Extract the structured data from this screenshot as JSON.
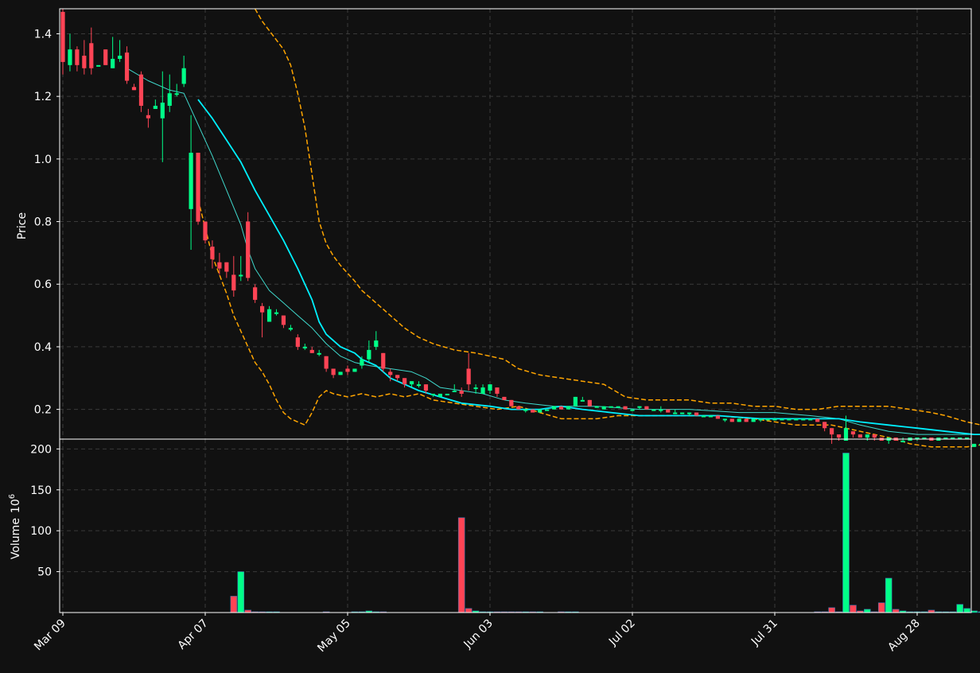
{
  "chart_data": {
    "type": "candlestick",
    "theme": {
      "background": "#111111",
      "up_color": "#00ff88",
      "down_color": "#ff4455",
      "ma_fast_color": "#00f0ff",
      "ma_slow_color": "#3fd8cc",
      "band_color": "#ffa500",
      "grid_color": "#3a3a3a",
      "text_color": "#ffffff"
    },
    "price_panel": {
      "ylabel": "Price",
      "ylim": [
        0.105,
        1.48
      ],
      "yticks": [
        0.2,
        0.4,
        0.6,
        0.8,
        1.0,
        1.2,
        1.4
      ],
      "ytick_labels": [
        "0.2",
        "0.4",
        "0.6",
        "0.8",
        "1.0",
        "1.2",
        "1.4"
      ],
      "grid": true
    },
    "volume_panel": {
      "ylabel": "Volume",
      "ylabel_exponent": "10",
      "ylabel_power": "6",
      "ylim": [
        0,
        212
      ],
      "yticks": [
        50,
        100,
        150,
        200
      ],
      "ytick_labels": [
        "50",
        "100",
        "150",
        "200"
      ],
      "grid": true
    },
    "x_axis": {
      "n_bars": 130,
      "ticks": [
        {
          "index": 0,
          "label": "Mar 09"
        },
        {
          "index": 20,
          "label": "Apr 07"
        },
        {
          "index": 40,
          "label": "May 05"
        },
        {
          "index": 60,
          "label": "Jun 03"
        },
        {
          "index": 80,
          "label": "Jul 02"
        },
        {
          "index": 100,
          "label": "Jul 31"
        },
        {
          "index": 120,
          "label": "Aug 28"
        }
      ]
    },
    "candles": [
      [
        1.47,
        1.31,
        1.48,
        1.27
      ],
      [
        1.3,
        1.35,
        1.4,
        1.28
      ],
      [
        1.35,
        1.3,
        1.36,
        1.28
      ],
      [
        1.33,
        1.29,
        1.38,
        1.27
      ],
      [
        1.37,
        1.29,
        1.42,
        1.27
      ],
      [
        1.3,
        1.3,
        1.3,
        1.3
      ],
      [
        1.35,
        1.3,
        1.35,
        1.3
      ],
      [
        1.29,
        1.32,
        1.39,
        1.29
      ],
      [
        1.32,
        1.33,
        1.38,
        1.31
      ],
      [
        1.34,
        1.25,
        1.36,
        1.24
      ],
      [
        1.23,
        1.22,
        1.24,
        1.22
      ],
      [
        1.27,
        1.17,
        1.28,
        1.15
      ],
      [
        1.14,
        1.13,
        1.16,
        1.1
      ],
      [
        1.16,
        1.17,
        1.19,
        1.16
      ],
      [
        1.13,
        1.18,
        1.28,
        0.99
      ],
      [
        1.17,
        1.21,
        1.27,
        1.15
      ],
      [
        1.21,
        1.21,
        1.24,
        1.2
      ],
      [
        1.24,
        1.29,
        1.33,
        1.23
      ],
      [
        0.84,
        1.02,
        1.14,
        0.71
      ],
      [
        1.02,
        0.8,
        1.02,
        0.79
      ],
      [
        0.8,
        0.74,
        0.8,
        0.73
      ],
      [
        0.72,
        0.68,
        0.74,
        0.65
      ],
      [
        0.67,
        0.65,
        0.7,
        0.63
      ],
      [
        0.67,
        0.64,
        0.67,
        0.62
      ],
      [
        0.63,
        0.58,
        0.69,
        0.56
      ],
      [
        0.63,
        0.63,
        0.69,
        0.61
      ],
      [
        0.8,
        0.62,
        0.83,
        0.61
      ],
      [
        0.59,
        0.55,
        0.6,
        0.54
      ],
      [
        0.53,
        0.51,
        0.54,
        0.43
      ],
      [
        0.48,
        0.52,
        0.53,
        0.48
      ],
      [
        0.51,
        0.51,
        0.52,
        0.5
      ],
      [
        0.5,
        0.47,
        0.5,
        0.46
      ],
      [
        0.46,
        0.46,
        0.47,
        0.45
      ],
      [
        0.43,
        0.4,
        0.44,
        0.39
      ],
      [
        0.4,
        0.4,
        0.41,
        0.39
      ],
      [
        0.39,
        0.38,
        0.4,
        0.38
      ],
      [
        0.38,
        0.38,
        0.39,
        0.37
      ],
      [
        0.37,
        0.33,
        0.37,
        0.32
      ],
      [
        0.33,
        0.31,
        0.33,
        0.3
      ],
      [
        0.31,
        0.32,
        0.32,
        0.31
      ],
      [
        0.33,
        0.32,
        0.34,
        0.31
      ],
      [
        0.32,
        0.33,
        0.33,
        0.32
      ],
      [
        0.34,
        0.36,
        0.37,
        0.33
      ],
      [
        0.36,
        0.39,
        0.42,
        0.35
      ],
      [
        0.4,
        0.42,
        0.45,
        0.39
      ],
      [
        0.38,
        0.33,
        0.38,
        0.32
      ],
      [
        0.32,
        0.31,
        0.33,
        0.29
      ],
      [
        0.31,
        0.3,
        0.31,
        0.29
      ],
      [
        0.3,
        0.28,
        0.3,
        0.27
      ],
      [
        0.28,
        0.29,
        0.29,
        0.27
      ],
      [
        0.28,
        0.28,
        0.29,
        0.27
      ],
      [
        0.28,
        0.26,
        0.28,
        0.25
      ],
      [
        0.25,
        0.25,
        0.25,
        0.24
      ],
      [
        0.24,
        0.25,
        0.25,
        0.24
      ],
      [
        0.25,
        0.25,
        0.25,
        0.25
      ],
      [
        0.26,
        0.26,
        0.28,
        0.26
      ],
      [
        0.26,
        0.25,
        0.27,
        0.24
      ],
      [
        0.33,
        0.28,
        0.38,
        0.26
      ],
      [
        0.27,
        0.27,
        0.28,
        0.25
      ],
      [
        0.25,
        0.27,
        0.28,
        0.25
      ],
      [
        0.26,
        0.28,
        0.28,
        0.25
      ],
      [
        0.27,
        0.25,
        0.27,
        0.24
      ],
      [
        0.24,
        0.23,
        0.24,
        0.23
      ],
      [
        0.23,
        0.21,
        0.23,
        0.21
      ],
      [
        0.21,
        0.2,
        0.21,
        0.2
      ],
      [
        0.2,
        0.2,
        0.2,
        0.19
      ],
      [
        0.2,
        0.19,
        0.2,
        0.19
      ],
      [
        0.19,
        0.2,
        0.2,
        0.19
      ],
      [
        0.2,
        0.2,
        0.2,
        0.2
      ],
      [
        0.2,
        0.21,
        0.21,
        0.2
      ],
      [
        0.21,
        0.2,
        0.21,
        0.2
      ],
      [
        0.2,
        0.21,
        0.21,
        0.2
      ],
      [
        0.21,
        0.24,
        0.24,
        0.21
      ],
      [
        0.23,
        0.23,
        0.24,
        0.23
      ],
      [
        0.23,
        0.21,
        0.23,
        0.21
      ],
      [
        0.21,
        0.21,
        0.21,
        0.21
      ],
      [
        0.2,
        0.21,
        0.21,
        0.2
      ],
      [
        0.21,
        0.21,
        0.21,
        0.21
      ],
      [
        0.21,
        0.21,
        0.21,
        0.21
      ],
      [
        0.21,
        0.2,
        0.21,
        0.2
      ],
      [
        0.2,
        0.2,
        0.2,
        0.2
      ],
      [
        0.21,
        0.21,
        0.21,
        0.2
      ],
      [
        0.21,
        0.2,
        0.21,
        0.2
      ],
      [
        0.2,
        0.2,
        0.2,
        0.2
      ],
      [
        0.2,
        0.2,
        0.21,
        0.19
      ],
      [
        0.2,
        0.19,
        0.2,
        0.19
      ],
      [
        0.19,
        0.19,
        0.2,
        0.19
      ],
      [
        0.19,
        0.19,
        0.19,
        0.19
      ],
      [
        0.19,
        0.19,
        0.19,
        0.18
      ],
      [
        0.19,
        0.18,
        0.19,
        0.18
      ],
      [
        0.18,
        0.18,
        0.18,
        0.18
      ],
      [
        0.18,
        0.18,
        0.18,
        0.18
      ],
      [
        0.18,
        0.17,
        0.18,
        0.17
      ],
      [
        0.17,
        0.17,
        0.17,
        0.16
      ],
      [
        0.17,
        0.16,
        0.17,
        0.16
      ],
      [
        0.16,
        0.17,
        0.17,
        0.16
      ],
      [
        0.17,
        0.16,
        0.17,
        0.16
      ],
      [
        0.16,
        0.17,
        0.17,
        0.16
      ],
      [
        0.17,
        0.17,
        0.17,
        0.16
      ],
      [
        0.17,
        0.17,
        0.17,
        0.17
      ],
      [
        0.17,
        0.17,
        0.17,
        0.17
      ],
      [
        0.17,
        0.17,
        0.17,
        0.17
      ],
      [
        0.17,
        0.17,
        0.17,
        0.17
      ],
      [
        0.17,
        0.17,
        0.17,
        0.17
      ],
      [
        0.17,
        0.17,
        0.17,
        0.17
      ],
      [
        0.17,
        0.17,
        0.17,
        0.17
      ],
      [
        0.17,
        0.16,
        0.17,
        0.16
      ],
      [
        0.16,
        0.14,
        0.16,
        0.13
      ],
      [
        0.14,
        0.12,
        0.14,
        0.09
      ],
      [
        0.12,
        0.11,
        0.12,
        0.1
      ],
      [
        0.1,
        0.14,
        0.18,
        0.1
      ],
      [
        0.13,
        0.12,
        0.13,
        0.11
      ],
      [
        0.12,
        0.11,
        0.12,
        0.11
      ],
      [
        0.11,
        0.12,
        0.12,
        0.1
      ],
      [
        0.12,
        0.11,
        0.12,
        0.1
      ],
      [
        0.11,
        0.1,
        0.11,
        0.1
      ],
      [
        0.1,
        0.11,
        0.11,
        0.09
      ],
      [
        0.11,
        0.1,
        0.11,
        0.1
      ],
      [
        0.1,
        0.1,
        0.11,
        0.1
      ],
      [
        0.1,
        0.11,
        0.11,
        0.1
      ],
      [
        0.11,
        0.11,
        0.11,
        0.1
      ],
      [
        0.11,
        0.11,
        0.11,
        0.11
      ],
      [
        0.11,
        0.1,
        0.11,
        0.1
      ],
      [
        0.1,
        0.11,
        0.11,
        0.1
      ],
      [
        0.11,
        0.11,
        0.11,
        0.11
      ],
      [
        0.11,
        0.11,
        0.11,
        0.11
      ],
      [
        0.11,
        0.11,
        0.11,
        0.11
      ],
      [
        0.11,
        0.11,
        0.11,
        0.11
      ],
      [
        0.08,
        0.09,
        0.09,
        0.08
      ],
      [
        0.09,
        0.09,
        0.09,
        0.08
      ]
    ],
    "volume": [
      0,
      0,
      0,
      0,
      0,
      0,
      0,
      0,
      0,
      0,
      0,
      0,
      0,
      0,
      0,
      0,
      0,
      0,
      0,
      0,
      0,
      0,
      0,
      0,
      20,
      50,
      3,
      1,
      0.5,
      0.3,
      0.2,
      0,
      0,
      0,
      0,
      0,
      0,
      0.5,
      0,
      0,
      0,
      0.5,
      1,
      2,
      1,
      0.5,
      0,
      0,
      0,
      0,
      0,
      0,
      0,
      0,
      0,
      0,
      116,
      5,
      2,
      1,
      0.5,
      0.3,
      0.2,
      0.2,
      0.5,
      0.2,
      0.2,
      0.2,
      0,
      0,
      1,
      0.5,
      0.2,
      0,
      0,
      0,
      0,
      0,
      0,
      0,
      0,
      0,
      0,
      0,
      0,
      0,
      0,
      0,
      0,
      0,
      0,
      0,
      0,
      0,
      0,
      0,
      0,
      0,
      0,
      0,
      0,
      0,
      0,
      0,
      0,
      0,
      0.5,
      1,
      6,
      0.5,
      195,
      9,
      2,
      4,
      1,
      12,
      42,
      4,
      2,
      1,
      1,
      1,
      3,
      1,
      0.5,
      0.5,
      10,
      5,
      2,
      1
    ],
    "ma_fast": [
      [
        19,
        1.19
      ],
      [
        21,
        1.13
      ],
      [
        23,
        1.06
      ],
      [
        25,
        0.99
      ],
      [
        27,
        0.9
      ],
      [
        29,
        0.82
      ],
      [
        31,
        0.74
      ],
      [
        33,
        0.65
      ],
      [
        35,
        0.55
      ],
      [
        36,
        0.48
      ],
      [
        37,
        0.44
      ],
      [
        39,
        0.4
      ],
      [
        41,
        0.38
      ],
      [
        42,
        0.36
      ],
      [
        44,
        0.34
      ],
      [
        46,
        0.3
      ],
      [
        48,
        0.28
      ],
      [
        50,
        0.26
      ],
      [
        53,
        0.24
      ],
      [
        56,
        0.22
      ],
      [
        60,
        0.21
      ],
      [
        63,
        0.2
      ],
      [
        67,
        0.2
      ],
      [
        70,
        0.21
      ],
      [
        73,
        0.2
      ],
      [
        77,
        0.19
      ],
      [
        81,
        0.18
      ],
      [
        86,
        0.18
      ],
      [
        92,
        0.18
      ],
      [
        98,
        0.17
      ],
      [
        104,
        0.17
      ],
      [
        109,
        0.17
      ],
      [
        112,
        0.16
      ],
      [
        116,
        0.15
      ],
      [
        120,
        0.14
      ],
      [
        124,
        0.13
      ],
      [
        128,
        0.12
      ],
      [
        130,
        0.12
      ]
    ],
    "ma_slow": [
      [
        9,
        1.29
      ],
      [
        12,
        1.25
      ],
      [
        15,
        1.22
      ],
      [
        17,
        1.21
      ],
      [
        19,
        1.11
      ],
      [
        21,
        1.01
      ],
      [
        23,
        0.9
      ],
      [
        25,
        0.79
      ],
      [
        26,
        0.71
      ],
      [
        27,
        0.65
      ],
      [
        29,
        0.58
      ],
      [
        31,
        0.54
      ],
      [
        33,
        0.5
      ],
      [
        35,
        0.46
      ],
      [
        37,
        0.41
      ],
      [
        39,
        0.37
      ],
      [
        41,
        0.35
      ],
      [
        43,
        0.34
      ],
      [
        46,
        0.33
      ],
      [
        49,
        0.32
      ],
      [
        51,
        0.3
      ],
      [
        53,
        0.27
      ],
      [
        56,
        0.26
      ],
      [
        59,
        0.25
      ],
      [
        62,
        0.23
      ],
      [
        65,
        0.22
      ],
      [
        69,
        0.21
      ],
      [
        75,
        0.21
      ],
      [
        81,
        0.2
      ],
      [
        88,
        0.2
      ],
      [
        95,
        0.19
      ],
      [
        100,
        0.19
      ],
      [
        105,
        0.18
      ],
      [
        109,
        0.17
      ],
      [
        112,
        0.15
      ],
      [
        116,
        0.13
      ],
      [
        120,
        0.12
      ],
      [
        124,
        0.12
      ],
      [
        128,
        0.12
      ],
      [
        130,
        0.12
      ]
    ],
    "band_upper": [
      [
        27,
        1.48
      ],
      [
        28,
        1.44
      ],
      [
        30,
        1.38
      ],
      [
        31,
        1.35
      ],
      [
        32,
        1.3
      ],
      [
        33,
        1.21
      ],
      [
        34,
        1.1
      ],
      [
        35,
        0.95
      ],
      [
        36,
        0.8
      ],
      [
        37,
        0.73
      ],
      [
        38,
        0.69
      ],
      [
        39,
        0.66
      ],
      [
        41,
        0.61
      ],
      [
        42,
        0.58
      ],
      [
        44,
        0.54
      ],
      [
        46,
        0.5
      ],
      [
        48,
        0.46
      ],
      [
        50,
        0.43
      ],
      [
        52,
        0.41
      ],
      [
        55,
        0.39
      ],
      [
        58,
        0.38
      ],
      [
        60,
        0.37
      ],
      [
        62,
        0.36
      ],
      [
        64,
        0.33
      ],
      [
        67,
        0.31
      ],
      [
        70,
        0.3
      ],
      [
        73,
        0.29
      ],
      [
        76,
        0.28
      ],
      [
        79,
        0.24
      ],
      [
        82,
        0.23
      ],
      [
        85,
        0.23
      ],
      [
        88,
        0.23
      ],
      [
        91,
        0.22
      ],
      [
        94,
        0.22
      ],
      [
        97,
        0.21
      ],
      [
        100,
        0.21
      ],
      [
        103,
        0.2
      ],
      [
        106,
        0.2
      ],
      [
        109,
        0.21
      ],
      [
        113,
        0.21
      ],
      [
        116,
        0.21
      ],
      [
        119,
        0.2
      ],
      [
        122,
        0.19
      ],
      [
        124,
        0.18
      ],
      [
        127,
        0.16
      ],
      [
        129,
        0.15
      ],
      [
        130,
        0.14
      ]
    ],
    "band_lower": [
      [
        19,
        0.87
      ],
      [
        20,
        0.78
      ],
      [
        21,
        0.69
      ],
      [
        23,
        0.57
      ],
      [
        24,
        0.5
      ],
      [
        25,
        0.45
      ],
      [
        26,
        0.4
      ],
      [
        27,
        0.35
      ],
      [
        28,
        0.32
      ],
      [
        29,
        0.28
      ],
      [
        30,
        0.23
      ],
      [
        31,
        0.19
      ],
      [
        32,
        0.17
      ],
      [
        33,
        0.16
      ],
      [
        34,
        0.15
      ],
      [
        35,
        0.19
      ],
      [
        36,
        0.24
      ],
      [
        37,
        0.26
      ],
      [
        38,
        0.25
      ],
      [
        40,
        0.24
      ],
      [
        42,
        0.25
      ],
      [
        44,
        0.24
      ],
      [
        46,
        0.25
      ],
      [
        48,
        0.24
      ],
      [
        50,
        0.25
      ],
      [
        52,
        0.23
      ],
      [
        55,
        0.22
      ],
      [
        58,
        0.21
      ],
      [
        61,
        0.2
      ],
      [
        64,
        0.21
      ],
      [
        67,
        0.19
      ],
      [
        70,
        0.17
      ],
      [
        75,
        0.17
      ],
      [
        78,
        0.18
      ],
      [
        81,
        0.18
      ],
      [
        86,
        0.18
      ],
      [
        92,
        0.18
      ],
      [
        97,
        0.17
      ],
      [
        103,
        0.15
      ],
      [
        108,
        0.15
      ],
      [
        112,
        0.13
      ],
      [
        116,
        0.11
      ],
      [
        119,
        0.09
      ],
      [
        122,
        0.08
      ],
      [
        127,
        0.08
      ],
      [
        130,
        0.09
      ]
    ]
  }
}
